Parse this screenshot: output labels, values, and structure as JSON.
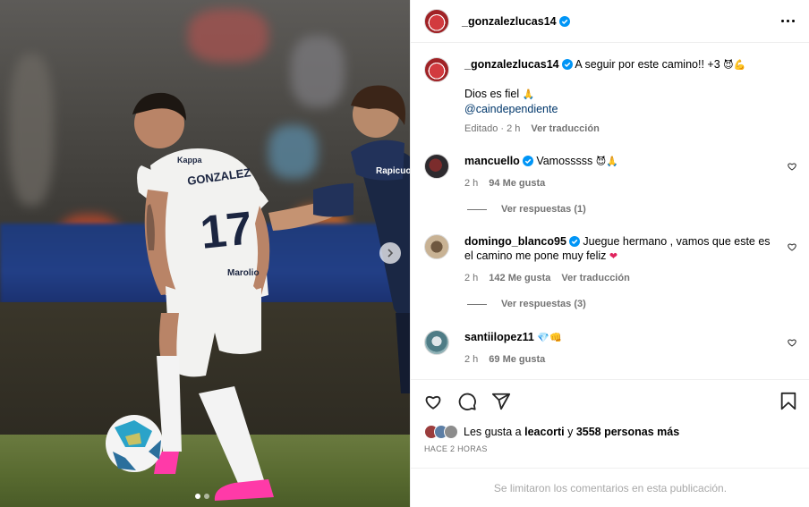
{
  "post": {
    "username": "_gonzalezlucas14",
    "more_icon": "more-horizontal-icon",
    "caption": {
      "username": "_gonzalezlucas14",
      "line1": "A seguir por este camino!! +3",
      "line1_emojis": "😈💪",
      "line2": "Dios es fiel",
      "line2_emoji": "🙏",
      "mention": "@caindependiente",
      "edited": "Editado · 2 h",
      "translate": "Ver traducción"
    }
  },
  "comments": [
    {
      "username": "mancuello",
      "verified": true,
      "text": "Vamosssss",
      "emojis": "😈🙏",
      "time": "2 h",
      "likes": "94 Me gusta",
      "translate": "",
      "replies": "Ver respuestas (1)"
    },
    {
      "username": "domingo_blanco95",
      "verified": true,
      "text": "Juegue hermano , vamos que este es el camino me pone muy feliz",
      "emojis": "❤",
      "time": "2 h",
      "likes": "142 Me gusta",
      "translate": "Ver traducción",
      "replies": "Ver respuestas (3)"
    },
    {
      "username": "santiilopez11",
      "verified": false,
      "text": "",
      "emojis": "💎👊",
      "time": "2 h",
      "likes": "69 Me gusta",
      "translate": "",
      "replies": ""
    }
  ],
  "actions": {
    "like_icon": "heart-icon",
    "comment_icon": "comment-icon",
    "share_icon": "send-icon",
    "save_icon": "bookmark-icon"
  },
  "likes_summary": {
    "prefix": "Les gusta a",
    "user": "leacorti",
    "mid": "y",
    "others": "3558 personas más"
  },
  "posted": "HACE 2 HORAS",
  "comments_limited": "Se limitaron los comentarios en esta publicación.",
  "carousel": {
    "next_icon": "chevron-right-icon",
    "slides": 2,
    "current": 1
  },
  "photo_text": {
    "shirt_name": "GONZALEZ",
    "shirt_number": "17",
    "shirt_brand": "Kappa",
    "sponsor": "Marolio",
    "opponent_sponsor": "Rapicuotas"
  },
  "colors": {
    "verified": "#0095f6",
    "muted": "#737373",
    "mention": "#00376b",
    "divider": "#efefef"
  }
}
